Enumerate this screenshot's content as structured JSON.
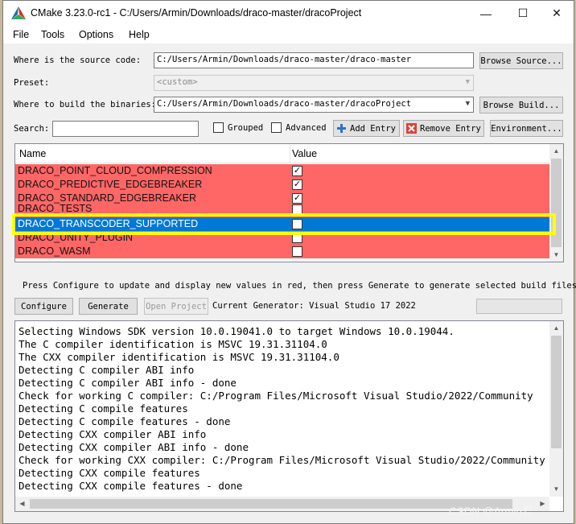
{
  "window": {
    "title": "CMake 3.23.0-rc1 - C:/Users/Armin/Downloads/draco-master/dracoProject",
    "controls": {
      "minimize": "—",
      "maximize": "☐",
      "close": "✕"
    }
  },
  "menu": [
    "File",
    "Tools",
    "Options",
    "Help"
  ],
  "source": {
    "label": "Where is the source code:",
    "value": "C:/Users/Armin/Downloads/draco-master/draco-master",
    "button": "Browse Source..."
  },
  "preset": {
    "label": "Preset:",
    "value": "<custom>"
  },
  "build": {
    "label": "Where to build the binaries:",
    "value": "C:/Users/Armin/Downloads/draco-master/dracoProject",
    "button": "Browse Build..."
  },
  "search": {
    "label": "Search:",
    "value": ""
  },
  "options": {
    "grouped": "Grouped",
    "advanced": "Advanced",
    "grouped_checked": false,
    "advanced_checked": false
  },
  "actions": {
    "add_entry": "Add Entry",
    "remove_entry": "Remove Entry",
    "environment": "Environment..."
  },
  "table": {
    "headers": {
      "name": "Name",
      "value": "Value"
    },
    "rows": [
      {
        "name": "DRACO_POINT_CLOUD_COMPRESSION",
        "checked": true
      },
      {
        "name": "DRACO_PREDICTIVE_EDGEBREAKER",
        "checked": true
      },
      {
        "name": "DRACO_STANDARD_EDGEBREAKER",
        "checked": true
      },
      {
        "name": "DRACO_TESTS",
        "checked": false
      },
      {
        "name": "DRACO_TRANSCODER_SUPPORTED",
        "checked": false,
        "selected": true
      },
      {
        "name": "DRACO_UNITY_PLUGIN",
        "checked": false
      },
      {
        "name": "DRACO_WASM",
        "checked": false
      }
    ]
  },
  "hint": "Press Configure to update and display new values in red, then press Generate to generate selected build files.",
  "buttons": {
    "configure": "Configure",
    "generate": "Generate",
    "open_project": "Open Project"
  },
  "generator": "Current Generator: Visual Studio 17 2022",
  "output": [
    "Selecting Windows SDK version 10.0.19041.0 to target Windows 10.0.19044.",
    "The C compiler identification is MSVC 19.31.31104.0",
    "The CXX compiler identification is MSVC 19.31.31104.0",
    "Detecting C compiler ABI info",
    "Detecting C compiler ABI info - done",
    "Check for working C compiler: C:/Program Files/Microsoft Visual Studio/2022/Community",
    "Detecting C compile features",
    "Detecting C compile features - done",
    "Detecting CXX compiler ABI info",
    "Detecting CXX compiler ABI info - done",
    "Check for working CXX compiler: C:/Program Files/Microsoft Visual Studio/2022/Community",
    "Detecting CXX compile features",
    "Detecting CXX compile features - done"
  ],
  "watermark": "CSDN @Armin君"
}
